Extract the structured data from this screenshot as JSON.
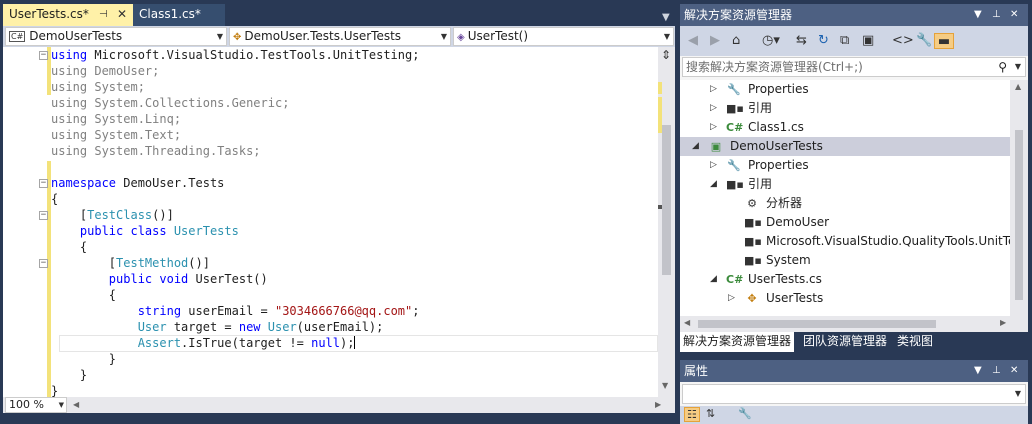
{
  "editor": {
    "tabs": [
      {
        "label": "UserTests.cs*",
        "active": true
      },
      {
        "label": "Class1.cs*",
        "active": false
      }
    ],
    "nav": {
      "project": "DemoUserTests",
      "type": "DemoUser.Tests.UserTests",
      "member": "UserTest()"
    },
    "zoom": "100 %",
    "code": [
      {
        "tokens": [
          {
            "c": "kw",
            "t": "using"
          },
          {
            "c": "dark",
            "t": " Microsoft.VisualStudio.TestTools.UnitTesting;"
          }
        ]
      },
      {
        "tokens": [
          {
            "c": "gray",
            "t": "using DemoUser;"
          }
        ]
      },
      {
        "tokens": [
          {
            "c": "gray",
            "t": "using System;"
          }
        ]
      },
      {
        "tokens": [
          {
            "c": "gray",
            "t": "using System.Collections.Generic;"
          }
        ]
      },
      {
        "tokens": [
          {
            "c": "gray",
            "t": "using System.Linq;"
          }
        ]
      },
      {
        "tokens": [
          {
            "c": "gray",
            "t": "using System.Text;"
          }
        ]
      },
      {
        "tokens": [
          {
            "c": "gray",
            "t": "using System.Threading.Tasks;"
          }
        ]
      },
      {
        "tokens": []
      },
      {
        "tokens": [
          {
            "c": "kw",
            "t": "namespace"
          },
          {
            "c": "dark",
            "t": " DemoUser.Tests"
          }
        ]
      },
      {
        "tokens": [
          {
            "c": "dark",
            "t": "{"
          }
        ]
      },
      {
        "tokens": [
          {
            "c": "dark",
            "t": "    ["
          },
          {
            "c": "ty",
            "t": "TestClass"
          },
          {
            "c": "dark",
            "t": "()]"
          }
        ]
      },
      {
        "tokens": [
          {
            "c": "kw",
            "t": "    public class"
          },
          {
            "c": "dark",
            "t": " "
          },
          {
            "c": "ty",
            "t": "UserTests"
          }
        ]
      },
      {
        "tokens": [
          {
            "c": "dark",
            "t": "    {"
          }
        ]
      },
      {
        "tokens": [
          {
            "c": "dark",
            "t": "        ["
          },
          {
            "c": "ty",
            "t": "TestMethod"
          },
          {
            "c": "dark",
            "t": "()]"
          }
        ]
      },
      {
        "tokens": [
          {
            "c": "kw",
            "t": "        public void"
          },
          {
            "c": "dark",
            "t": " UserTest()"
          }
        ]
      },
      {
        "tokens": [
          {
            "c": "dark",
            "t": "        {"
          }
        ]
      },
      {
        "tokens": [
          {
            "c": "kw",
            "t": "            string"
          },
          {
            "c": "dark",
            "t": " userEmail = "
          },
          {
            "c": "st",
            "t": "\"3034666766@qq.com\""
          },
          {
            "c": "dark",
            "t": ";"
          }
        ]
      },
      {
        "tokens": [
          {
            "c": "ty",
            "t": "            User"
          },
          {
            "c": "dark",
            "t": " target = "
          },
          {
            "c": "kw",
            "t": "new"
          },
          {
            "c": "dark",
            "t": " "
          },
          {
            "c": "ty",
            "t": "User"
          },
          {
            "c": "dark",
            "t": "(userEmail);"
          }
        ]
      },
      {
        "tokens": [
          {
            "c": "ty",
            "t": "            Assert"
          },
          {
            "c": "dark",
            "t": ".IsTrue(target != "
          },
          {
            "c": "kw",
            "t": "null"
          },
          {
            "c": "dark",
            "t": ");"
          }
        ]
      },
      {
        "tokens": [
          {
            "c": "dark",
            "t": "        }"
          }
        ]
      },
      {
        "tokens": [
          {
            "c": "dark",
            "t": "    }"
          }
        ]
      },
      {
        "tokens": [
          {
            "c": "dark",
            "t": "}"
          }
        ]
      }
    ]
  },
  "solution_explorer": {
    "title": "解决方案资源管理器",
    "search_placeholder": "搜索解决方案资源管理器(Ctrl+;)",
    "tree": [
      {
        "label": "Properties",
        "icon": "wrench-icon",
        "expander": "▷",
        "level": 1
      },
      {
        "label": "引用",
        "icon": "reference-icon",
        "expander": "▷",
        "level": 1
      },
      {
        "label": "Class1.cs",
        "icon": "csharp-file-icon",
        "expander": "▷",
        "level": 1
      },
      {
        "label": "DemoUserTests",
        "icon": "test-project-icon",
        "expander": "◢",
        "level": 0,
        "selected": true
      },
      {
        "label": "Properties",
        "icon": "wrench-icon",
        "expander": "▷",
        "level": 1
      },
      {
        "label": "引用",
        "icon": "reference-icon",
        "expander": "◢",
        "level": 1
      },
      {
        "label": "分析器",
        "icon": "analyzer-icon",
        "expander": "",
        "level": 2
      },
      {
        "label": "DemoUser",
        "icon": "reference-icon",
        "expander": "",
        "level": 2
      },
      {
        "label": "Microsoft.VisualStudio.QualityTools.UnitTe",
        "icon": "reference-icon",
        "expander": "",
        "level": 2
      },
      {
        "label": "System",
        "icon": "reference-icon",
        "expander": "",
        "level": 2
      },
      {
        "label": "UserTests.cs",
        "icon": "csharp-file-icon",
        "expander": "◢",
        "level": 1
      },
      {
        "label": "UserTests",
        "icon": "class-icon",
        "expander": "▷",
        "level": 2
      }
    ],
    "bottom_tabs": [
      {
        "label": "解决方案资源管理器",
        "active": true
      },
      {
        "label": "团队资源管理器",
        "active": false
      },
      {
        "label": "类视图",
        "active": false
      }
    ]
  },
  "properties": {
    "title": "属性"
  },
  "colors": {
    "frame": "#293955",
    "title_bar": "#4d6082",
    "active_tab": "#fff1a8",
    "keyword": "#0000ff",
    "type": "#2b91af",
    "string": "#a31515",
    "selection": "#cccedb"
  }
}
